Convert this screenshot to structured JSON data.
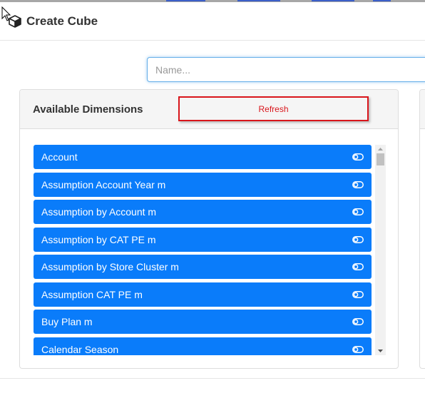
{
  "header": {
    "title": "Create Cube",
    "icon": "cube-icon"
  },
  "name_input": {
    "value": "",
    "placeholder": "Name..."
  },
  "dimensions_panel": {
    "title": "Available Dimensions",
    "refresh_label": "Refresh",
    "items": [
      {
        "label": "Account"
      },
      {
        "label": "Assumption Account Year m"
      },
      {
        "label": "Assumption by Account m"
      },
      {
        "label": "Assumption by CAT PE m"
      },
      {
        "label": "Assumption by Store Cluster m"
      },
      {
        "label": "Assumption CAT PE m"
      },
      {
        "label": "Buy Plan m"
      },
      {
        "label": "Calendar Season"
      }
    ],
    "item_icon": "toggle-icon"
  },
  "colors": {
    "item_background": "#0a7cfa",
    "refresh_accent": "#d9151b",
    "input_focus": "#66afe9"
  }
}
